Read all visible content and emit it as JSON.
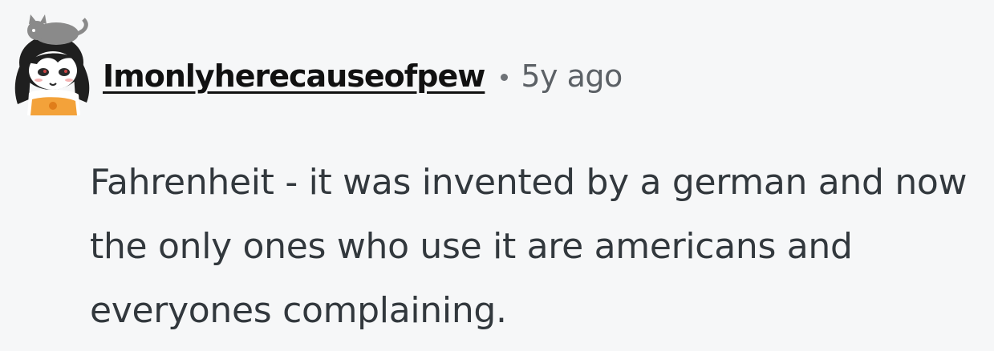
{
  "comment": {
    "author": "Imonlyherecauseofpew",
    "separator": "•",
    "age": "5y ago",
    "text": "Fahrenheit - it was invented by a german and now the only ones who use it are americans and everyones complaining."
  },
  "avatar": {
    "icon": "cartoon-girl-with-cat-avatar",
    "colors": {
      "hair": "#1f1f1f",
      "cat": "#8a8a8a",
      "face": "#ffffff",
      "shirt": "#f3a23a"
    }
  },
  "colors": {
    "background": "#f6f7f8",
    "username": "#111111",
    "meta": "#5c6166",
    "body_text": "#32383d"
  }
}
